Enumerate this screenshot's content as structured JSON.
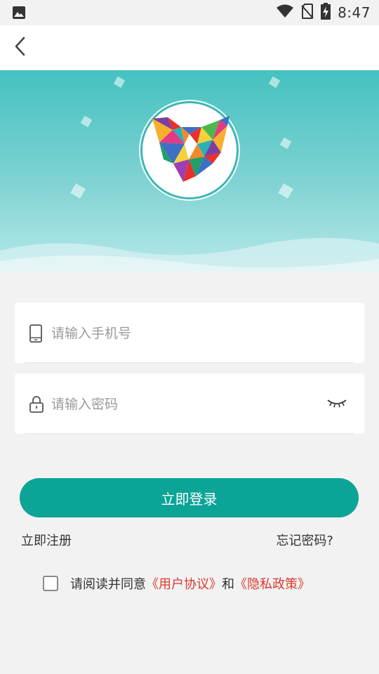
{
  "status_bar": {
    "time": "8:47",
    "icons": [
      "image-notification-icon",
      "wifi-icon",
      "no-sim-icon",
      "battery-charging-icon"
    ]
  },
  "app_bar": {
    "back_icon": "chevron-left-icon"
  },
  "form": {
    "phone": {
      "placeholder": "请输入手机号",
      "value": "",
      "icon": "phone-icon"
    },
    "password": {
      "placeholder": "请输入密码",
      "value": "",
      "icon": "lock-icon",
      "toggle_icon": "eye-closed-icon"
    }
  },
  "buttons": {
    "login": "立即登录"
  },
  "links": {
    "register": "立即注册",
    "forgot_password": "忘记密码?"
  },
  "agreement": {
    "checked": false,
    "prefix": "请阅读并同意",
    "user_agreement": "《用户协议》",
    "conjunction": "和",
    "privacy_policy": "《隐私政策》"
  },
  "colors": {
    "primary": "#0ca496",
    "hero_top": "#44c2c0",
    "link_red": "#d93a2f",
    "background": "#f2f2f2"
  }
}
